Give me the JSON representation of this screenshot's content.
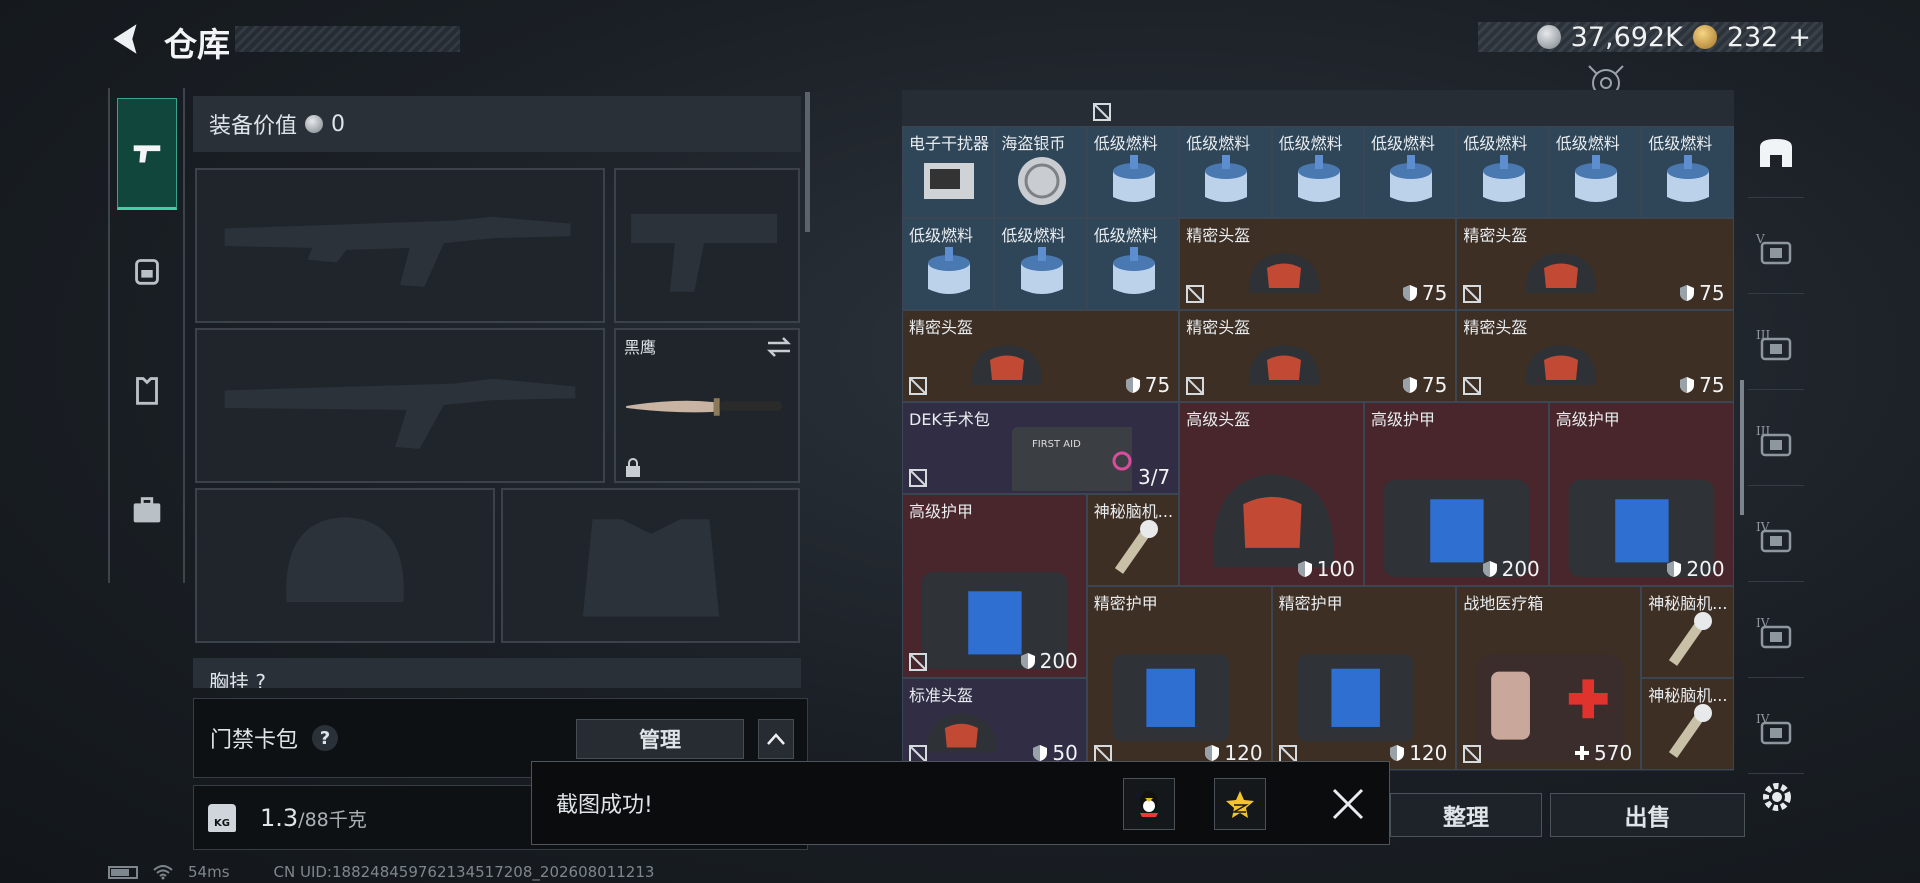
{
  "header": {
    "title": "仓库"
  },
  "currency": {
    "silver": "37,692K",
    "gold": "232",
    "add": "+"
  },
  "left_tabs": [
    "weapon-tab",
    "backpack-tab",
    "vest-tab",
    "case-tab"
  ],
  "equipment": {
    "value_label": "装备价值",
    "value_amount": "0",
    "melee_name": "黑鹰",
    "chest_label": "胸挂",
    "chest_hint": "?"
  },
  "card_pack": {
    "label": "门禁卡包",
    "help": "?",
    "manage": "管理"
  },
  "weight": {
    "current": "1.3",
    "max": "/88千克",
    "unit_icon": "KG"
  },
  "grid": [
    {
      "name": "电子干扰器",
      "col": 0,
      "row": 0,
      "w": 1,
      "h": 1,
      "color": "c-blue",
      "icon": "device"
    },
    {
      "name": "海盗银币",
      "col": 1,
      "row": 0,
      "w": 1,
      "h": 1,
      "color": "c-blue",
      "icon": "coin"
    },
    {
      "name": "低级燃料",
      "col": 2,
      "row": 0,
      "w": 1,
      "h": 1,
      "color": "c-blue",
      "icon": "fuel"
    },
    {
      "name": "低级燃料",
      "col": 3,
      "row": 0,
      "w": 1,
      "h": 1,
      "color": "c-blue",
      "icon": "fuel"
    },
    {
      "name": "低级燃料",
      "col": 4,
      "row": 0,
      "w": 1,
      "h": 1,
      "color": "c-blue",
      "icon": "fuel"
    },
    {
      "name": "低级燃料",
      "col": 5,
      "row": 0,
      "w": 1,
      "h": 1,
      "color": "c-blue",
      "icon": "fuel"
    },
    {
      "name": "低级燃料",
      "col": 6,
      "row": 0,
      "w": 1,
      "h": 1,
      "color": "c-blue",
      "icon": "fuel"
    },
    {
      "name": "低级燃料",
      "col": 7,
      "row": 0,
      "w": 1,
      "h": 1,
      "color": "c-blue",
      "icon": "fuel"
    },
    {
      "name": "低级燃料",
      "col": 8,
      "row": 0,
      "w": 1,
      "h": 1,
      "color": "c-blue",
      "icon": "fuel"
    },
    {
      "name": "低级燃料",
      "col": 0,
      "row": 1,
      "w": 1,
      "h": 1,
      "color": "c-blue",
      "icon": "fuel"
    },
    {
      "name": "低级燃料",
      "col": 1,
      "row": 1,
      "w": 1,
      "h": 1,
      "color": "c-blue",
      "icon": "fuel"
    },
    {
      "name": "低级燃料",
      "col": 2,
      "row": 1,
      "w": 1,
      "h": 1,
      "color": "c-blue",
      "icon": "fuel"
    },
    {
      "name": "精密头盔",
      "col": 3,
      "row": 1,
      "w": 3,
      "h": 1,
      "color": "c-brown",
      "icon": "helmet",
      "value": "75",
      "lock": true,
      "val_icon": "shield"
    },
    {
      "name": "精密头盔",
      "col": 6,
      "row": 1,
      "w": 3,
      "h": 1,
      "color": "c-brown",
      "icon": "helmet",
      "value": "75",
      "lock": true,
      "val_icon": "shield"
    },
    {
      "name": "精密头盔",
      "col": 0,
      "row": 2,
      "w": 3,
      "h": 1,
      "color": "c-brown",
      "icon": "helmet",
      "value": "75",
      "lock": true,
      "val_icon": "shield"
    },
    {
      "name": "精密头盔",
      "col": 3,
      "row": 2,
      "w": 3,
      "h": 1,
      "color": "c-brown",
      "icon": "helmet",
      "value": "75",
      "lock": true,
      "val_icon": "shield"
    },
    {
      "name": "精密头盔",
      "col": 6,
      "row": 2,
      "w": 3,
      "h": 1,
      "color": "c-brown",
      "icon": "helmet",
      "value": "75",
      "lock": true,
      "val_icon": "shield"
    },
    {
      "name": "DEK手术包",
      "col": 0,
      "row": 3,
      "w": 3,
      "h": 1,
      "color": "c-purple",
      "icon": "medkit",
      "value": "3/7",
      "lock": true,
      "val_icon": ""
    },
    {
      "name": "高级头盔",
      "col": 3,
      "row": 3,
      "w": 2,
      "h": 2,
      "color": "c-red",
      "icon": "helmet-big",
      "value": "100",
      "lock": false,
      "val_icon": "shield"
    },
    {
      "name": "高级护甲",
      "col": 5,
      "row": 3,
      "w": 2,
      "h": 2,
      "color": "c-red",
      "icon": "armor-big",
      "value": "200",
      "lock": false,
      "val_icon": "shield"
    },
    {
      "name": "高级护甲",
      "col": 7,
      "row": 3,
      "w": 2,
      "h": 2,
      "color": "c-red",
      "icon": "armor-big",
      "value": "200",
      "lock": false,
      "val_icon": "shield"
    },
    {
      "name": "高级护甲",
      "col": 0,
      "row": 4,
      "w": 2,
      "h": 2,
      "color": "c-red",
      "icon": "armor-big",
      "value": "200",
      "lock": true,
      "val_icon": "shield"
    },
    {
      "name": "神秘脑机...",
      "col": 2,
      "row": 4,
      "w": 1,
      "h": 1,
      "color": "c-brown",
      "icon": "chip"
    },
    {
      "name": "精密护甲",
      "col": 2,
      "row": 5,
      "w": 2,
      "h": 2,
      "color": "c-brown",
      "icon": "armor",
      "value": "120",
      "lock": true,
      "val_icon": "shield"
    },
    {
      "name": "精密护甲",
      "col": 4,
      "row": 5,
      "w": 2,
      "h": 2,
      "color": "c-brown",
      "icon": "armor",
      "value": "120",
      "lock": true,
      "val_icon": "shield"
    },
    {
      "name": "战地医疗箱",
      "col": 6,
      "row": 5,
      "w": 2,
      "h": 2,
      "color": "c-brown",
      "icon": "firstaid",
      "value": "570",
      "lock": true,
      "val_icon": "plus"
    },
    {
      "name": "神秘脑机...",
      "col": 8,
      "row": 5,
      "w": 1,
      "h": 1,
      "color": "c-brown",
      "icon": "chip"
    },
    {
      "name": "标准头盔",
      "col": 0,
      "row": 6,
      "w": 2,
      "h": 1,
      "color": "c-purple",
      "icon": "helmet",
      "value": "50",
      "lock": true,
      "val_icon": "shield"
    },
    {
      "name": "神秘脑机...",
      "col": 8,
      "row": 6,
      "w": 1,
      "h": 1,
      "color": "c-brown",
      "icon": "chip"
    }
  ],
  "filters": [
    "all",
    "V",
    "III",
    "III",
    "IV",
    "IV",
    "IV"
  ],
  "actions": {
    "sort": "整理",
    "sell": "出售"
  },
  "toast": {
    "message": "截图成功!"
  },
  "status": {
    "ping": "54ms",
    "uid": "CN UID:1882484597621345172​08_202608011213"
  }
}
